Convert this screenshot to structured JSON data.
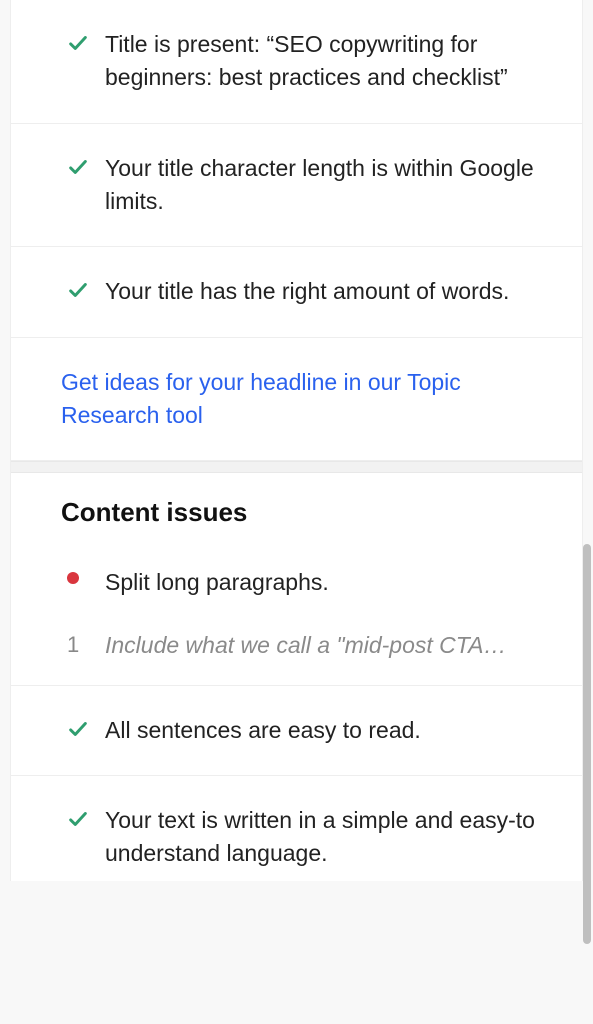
{
  "title_checks": [
    {
      "text": "Title is present: “SEO copywriting for beginners: best practices and checklist”"
    },
    {
      "text": "Your title character length is within Google limits."
    },
    {
      "text": "Your title has the right amount of words."
    }
  ],
  "headline_link": "Get ideas for your headline in our Topic Research tool",
  "content_issues_heading": "Content issues",
  "content_issues": {
    "split_paragraphs": {
      "label": "Split long paragraphs.",
      "quote_num": "1",
      "quote_text": "Include what we call a \"mid-post CTA…"
    },
    "easy_read": "All sentences are easy to read.",
    "simple_language": "Your text is written in a simple and easy-to understand language."
  }
}
